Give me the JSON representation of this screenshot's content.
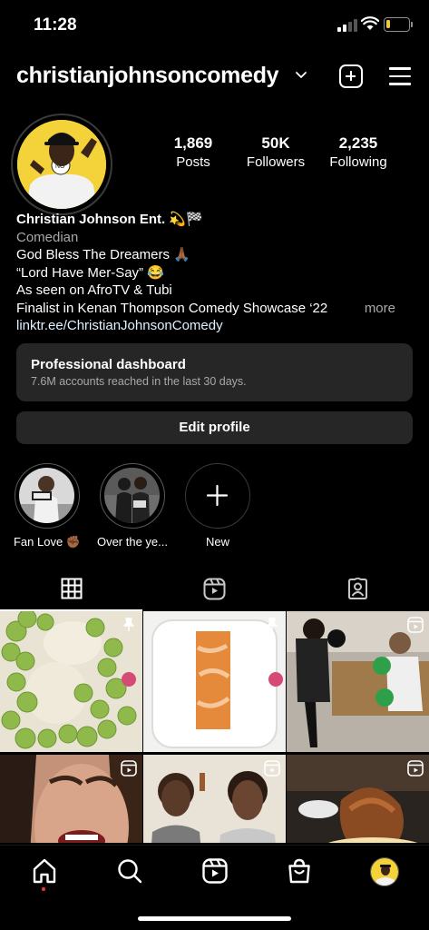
{
  "status_bar": {
    "time": "11:28"
  },
  "header": {
    "username": "christianjohnsoncomedy",
    "icons": {
      "chevron": "chevron-down-icon",
      "new_post": "plus-square-icon",
      "menu": "hamburger-menu-icon"
    }
  },
  "stats": [
    {
      "value": "1,869",
      "label": "Posts"
    },
    {
      "value": "50K",
      "label": "Followers"
    },
    {
      "value": "2,235",
      "label": "Following"
    }
  ],
  "bio": {
    "name": "Christian Johnson Ent. 💫🏁",
    "category": "Comedian",
    "lines": [
      "God Bless The Dreamers 🙏🏾",
      "“Lord Have Mer-Say” 😂",
      "As seen on AfroTV & Tubi",
      "Finalist in Kenan Thompson Comedy Showcase ‘22"
    ],
    "more": "more",
    "link": "linktr.ee/ChristianJohnsonComedy"
  },
  "dashboard": {
    "title": "Professional dashboard",
    "subtitle": "7.6M accounts reached in the last 30 days."
  },
  "edit_profile_label": "Edit profile",
  "highlights": [
    {
      "label": "Fan Love ✊🏾"
    },
    {
      "label": "Over the ye..."
    },
    {
      "label": "New"
    }
  ],
  "tabs": [
    {
      "icon": "grid-icon",
      "selected": true
    },
    {
      "icon": "reels-icon",
      "selected": false
    },
    {
      "icon": "tagged-person-icon",
      "selected": false
    }
  ],
  "bottom_nav": [
    {
      "icon": "home-icon"
    },
    {
      "icon": "search-icon"
    },
    {
      "icon": "reels-icon"
    },
    {
      "icon": "shop-icon"
    },
    {
      "icon": "profile-avatar-icon"
    }
  ],
  "colors": {
    "background": "#000000",
    "surface": "#262626",
    "secondary_text": "#a8a8a8",
    "link": "#e0f1ff",
    "notification": "#ff3040",
    "avatar_yellow": "#f3d23a"
  }
}
